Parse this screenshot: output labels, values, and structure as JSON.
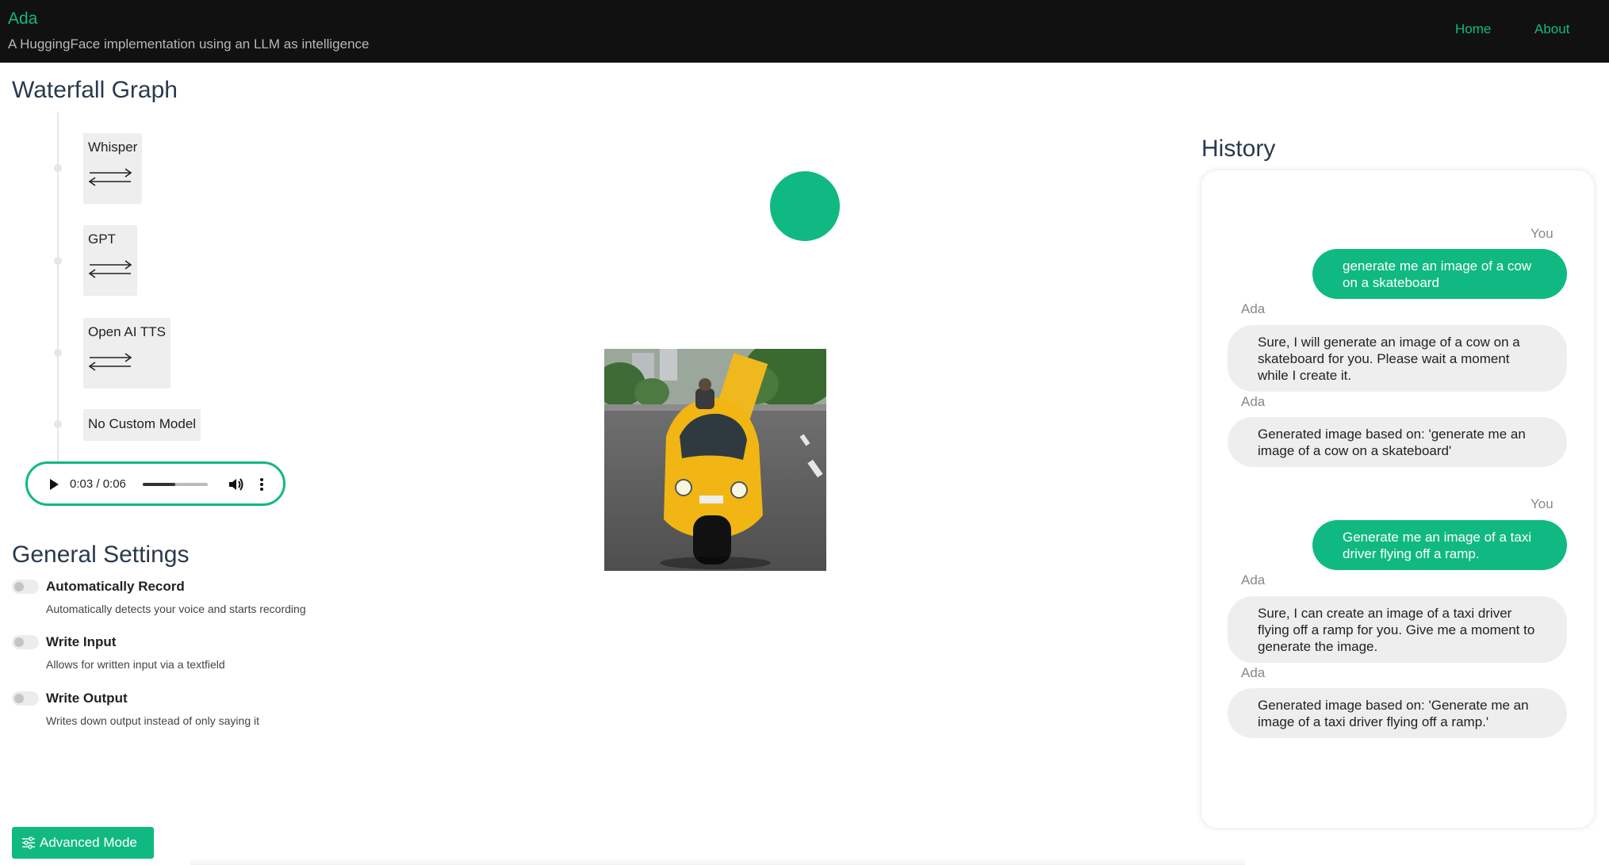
{
  "header": {
    "app_title": "Ada",
    "subtitle": "A HuggingFace implementation using an LLM as intelligence",
    "nav": [
      "Home",
      "About"
    ]
  },
  "waterfall": {
    "title": "Waterfall Graph",
    "nodes": [
      "Whisper",
      "GPT",
      "Open AI TTS",
      "No Custom Model"
    ]
  },
  "audio": {
    "time": "0:03 / 0:06",
    "progress": 0.5
  },
  "settings": {
    "title": "General Settings",
    "items": [
      {
        "title": "Automatically Record",
        "desc": "Automatically detects your voice and starts recording",
        "enabled": false
      },
      {
        "title": "Write Input",
        "desc": "Allows for written input via a textfield",
        "enabled": false
      },
      {
        "title": "Write Output",
        "desc": "Writes down output instead of only saying it",
        "enabled": false
      }
    ],
    "advanced_button": "Advanced Mode"
  },
  "history": {
    "title": "History",
    "messages": [
      {
        "speaker": "You",
        "text": "generate me an image of a cow on a skateboard"
      },
      {
        "speaker": "Ada",
        "text": "Sure, I will generate an image of a cow on a skateboard for you. Please wait a moment while I create it."
      },
      {
        "speaker": "Ada",
        "text": "Generated image based on: 'generate me an image of a cow on a skateboard'"
      },
      {
        "speaker": "You",
        "text": "Generate me an image of a taxi driver flying off a ramp."
      },
      {
        "speaker": "Ada",
        "text": "Sure, I can create an image of a taxi driver flying off a ramp for you. Give me a moment to generate the image."
      },
      {
        "speaker": "Ada",
        "text": "Generated image based on: 'Generate me an image of a taxi driver flying off a ramp.'"
      }
    ]
  },
  "colors": {
    "accent": "#10b981",
    "header_bg": "#111111",
    "bubble_ada": "#eeeeee"
  }
}
